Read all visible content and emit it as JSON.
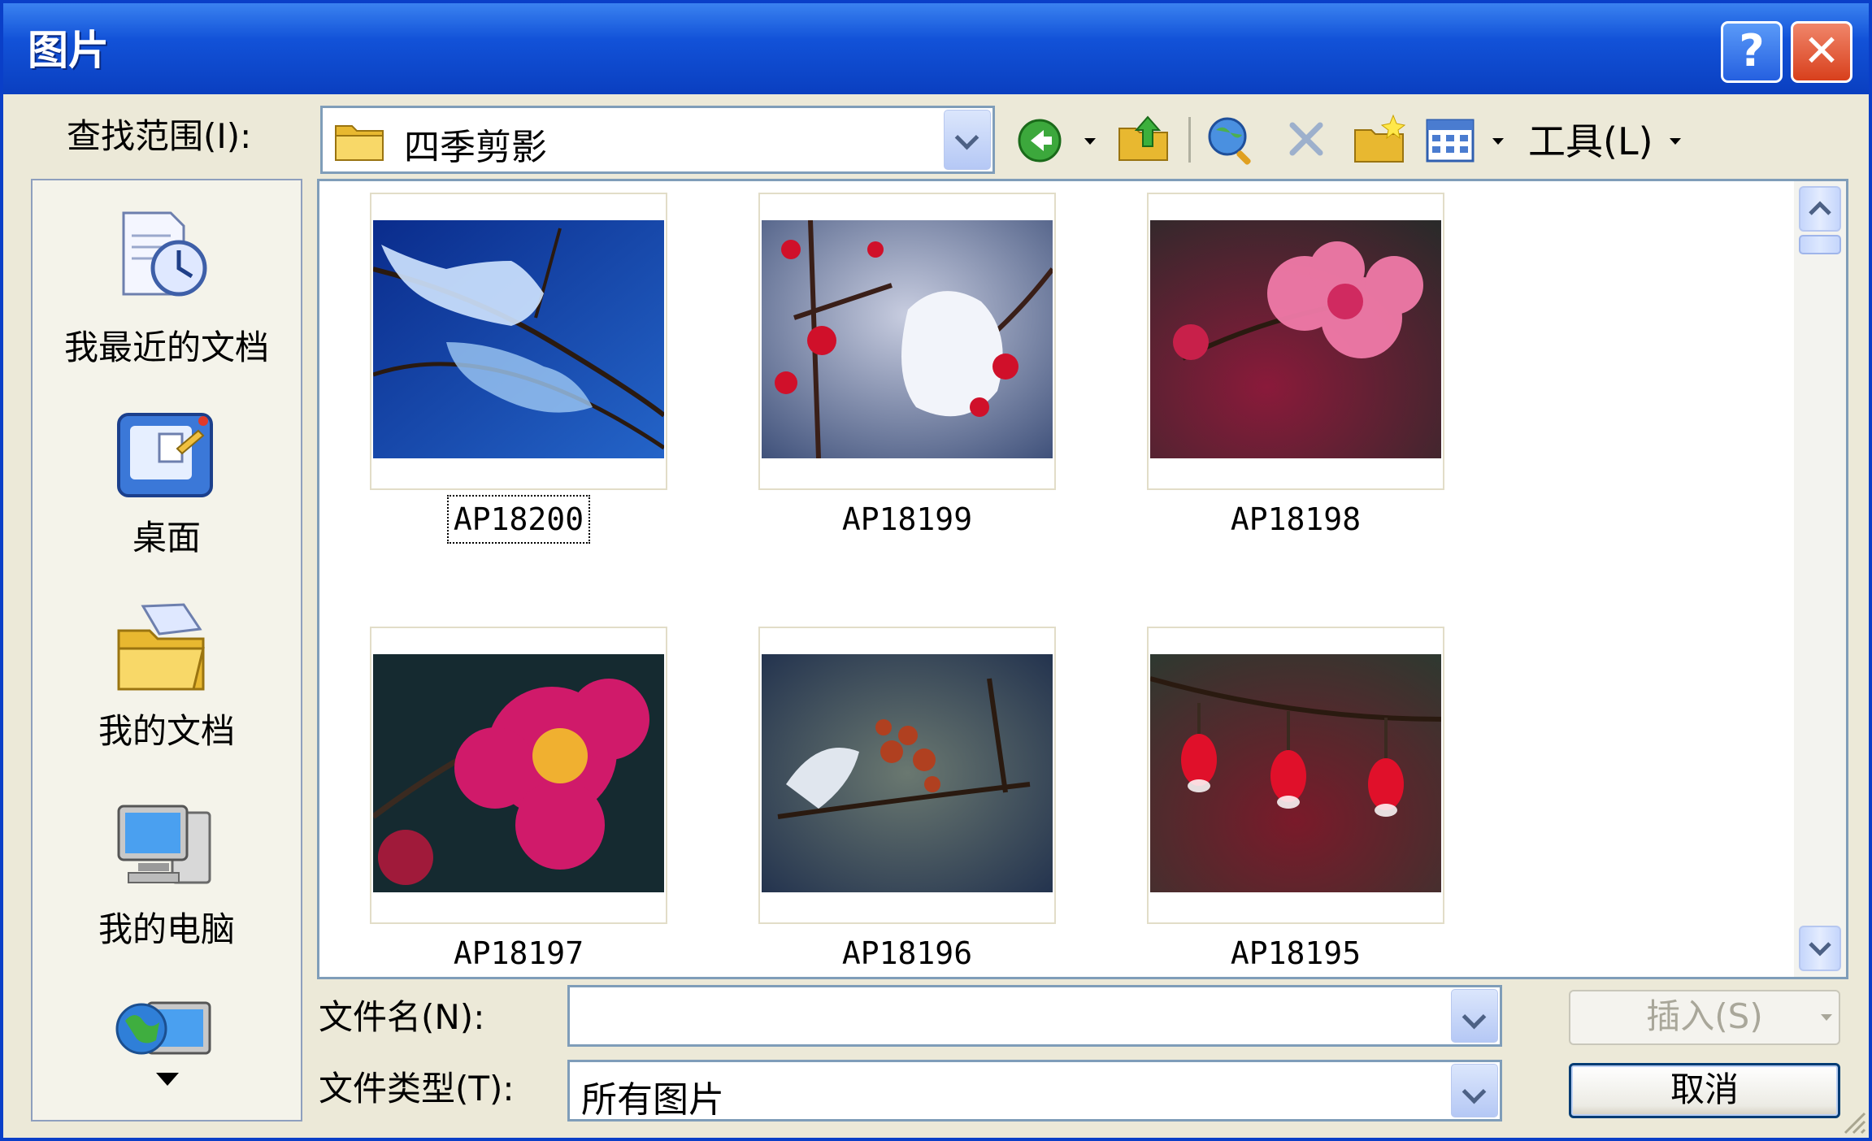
{
  "window": {
    "title": "图片",
    "help_label": "?",
    "close_label": "✕"
  },
  "toolbar": {
    "look_in_label": "查找范围(I):",
    "look_in_value": "四季剪影",
    "tools_label": "工具(L)",
    "icons": [
      "back-icon",
      "up-folder-icon",
      "search-web-icon",
      "delete-icon",
      "new-folder-icon",
      "views-icon"
    ]
  },
  "places": [
    {
      "label": "我最近的文档",
      "icon": "recent-documents-icon"
    },
    {
      "label": "桌面",
      "icon": "desktop-icon"
    },
    {
      "label": "我的文档",
      "icon": "my-documents-icon"
    },
    {
      "label": "我的电脑",
      "icon": "my-computer-icon"
    },
    {
      "label": "",
      "icon": "network-places-icon"
    }
  ],
  "files": [
    {
      "name": "AP18200",
      "selected": true
    },
    {
      "name": "AP18199"
    },
    {
      "name": "AP18198"
    },
    {
      "name": "AP18197"
    },
    {
      "name": "AP18196"
    },
    {
      "name": "AP18195"
    }
  ],
  "form": {
    "filename_label": "文件名(N):",
    "filename_value": "",
    "filetype_label": "文件类型(T):",
    "filetype_value": "所有图片"
  },
  "buttons": {
    "insert": "插入(S)",
    "cancel": "取消"
  },
  "colors": {
    "titlebar": "#0a3fc0",
    "dialog_bg": "#ece9d8",
    "border": "#7f9db9"
  }
}
